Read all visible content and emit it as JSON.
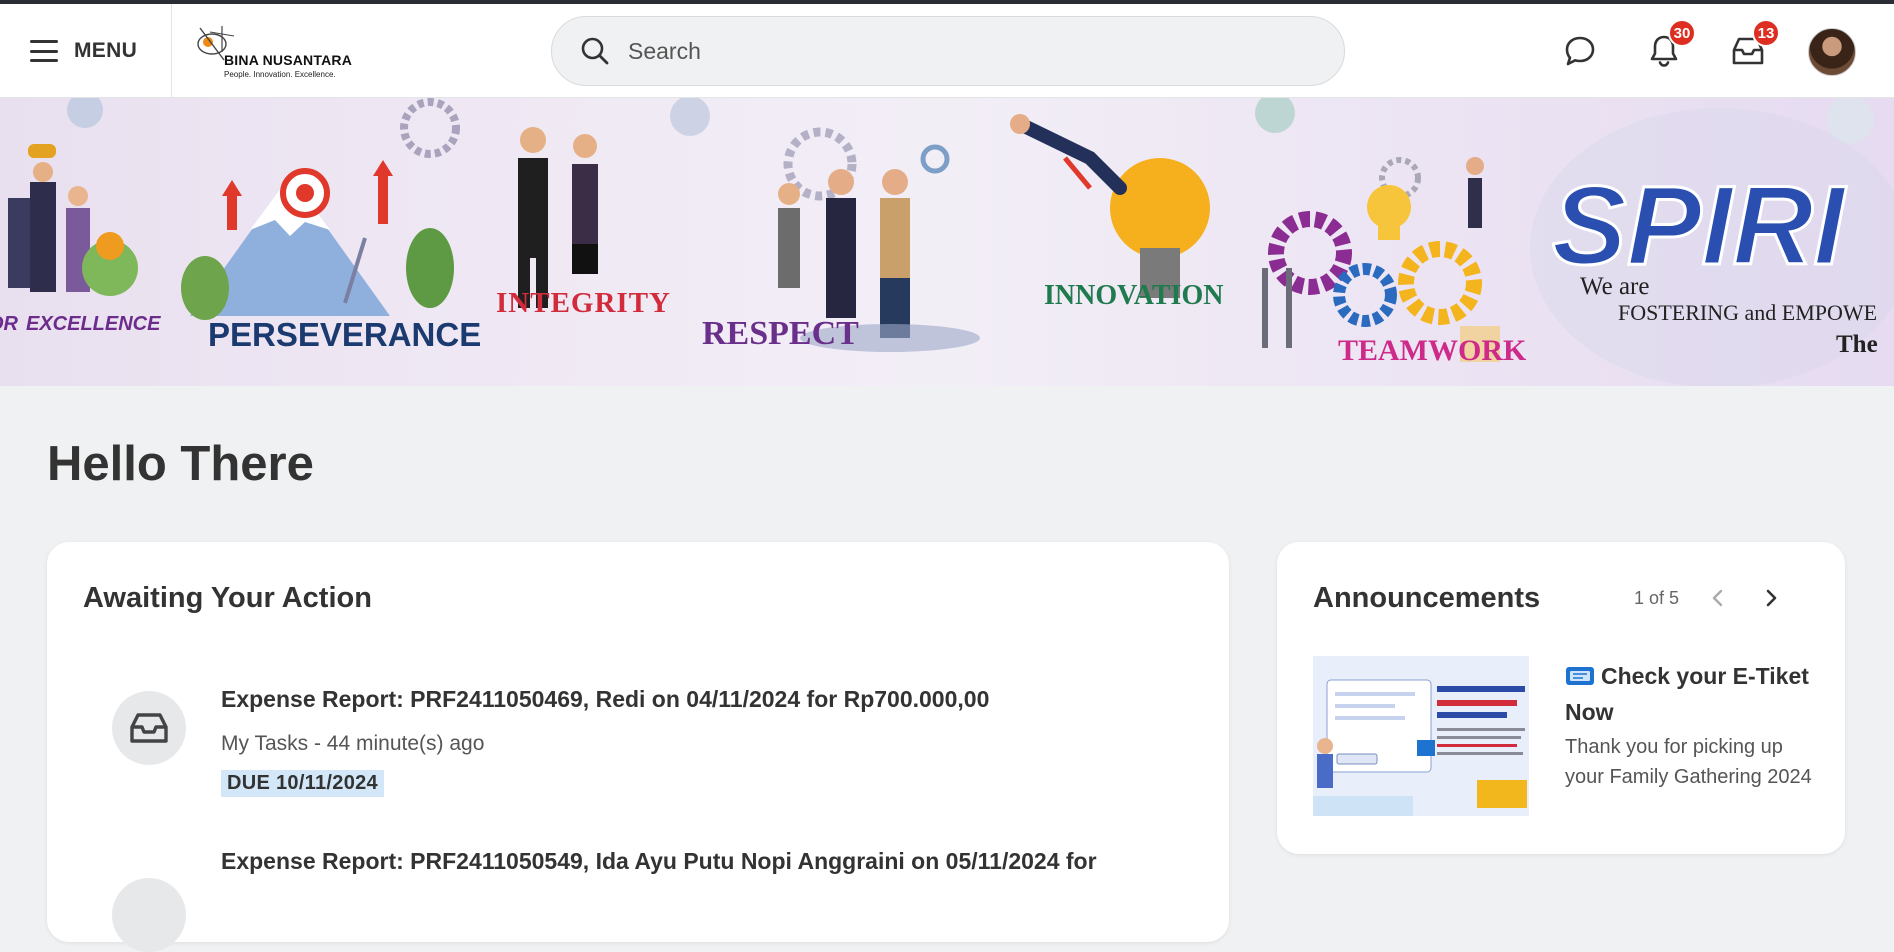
{
  "header": {
    "menu_label": "MENU",
    "logo": {
      "name": "BINA NUSANTARA",
      "tagline": "People.  Innovation.  Excellence."
    },
    "search_placeholder": "Search",
    "notifications_count": "30",
    "inbox_count": "13"
  },
  "banner": {
    "values": [
      "EXCELLENCE",
      "PERSEVERANCE",
      "INTEGRITY",
      "RESPECT",
      "INNOVATION",
      "TEAMWORK"
    ],
    "prefix": "OR",
    "spirit": "SPIRI",
    "line1": "We are",
    "line2": "FOSTERING and EMPOWE",
    "line3": "The"
  },
  "greeting": "Hello There",
  "awaiting": {
    "title": "Awaiting Your Action",
    "tasks": [
      {
        "title": "Expense Report: PRF2411050469, Redi on 04/11/2024 for Rp700.000,00",
        "meta": "My Tasks - 44 minute(s) ago",
        "due": "DUE 10/11/2024"
      },
      {
        "title": "Expense Report: PRF2411050549, Ida Ayu Putu Nopi Anggraini on 05/11/2024 for",
        "meta": "",
        "due": ""
      }
    ]
  },
  "announcements": {
    "title": "Announcements",
    "pager": "1 of 5",
    "item": {
      "headline": "Check your E-Tiket Now",
      "body": "Thank you for picking up your Family Gathering 2024"
    }
  },
  "colors": {
    "accent_blue": "#d4e7f8",
    "badge_red": "#de2e21",
    "topbar": "#2b2d35",
    "background": "#f0f1f2"
  }
}
